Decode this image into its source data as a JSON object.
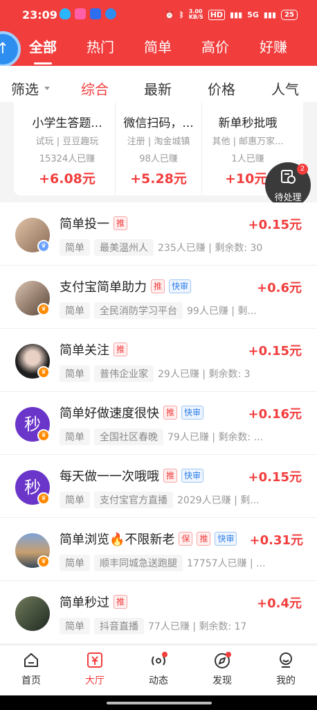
{
  "status_bar": {
    "time": "23:09",
    "speed": "3.00\nKB/S",
    "battery": "25",
    "signal": "5G",
    "network": "HD"
  },
  "top_tabs": [
    {
      "label": "全部"
    },
    {
      "label": "热门"
    },
    {
      "label": "简单"
    },
    {
      "label": "高价"
    },
    {
      "label": "好赚"
    }
  ],
  "filter": {
    "shaixuan": "筛选",
    "sorts": [
      "综合",
      "最新",
      "价格",
      "人气"
    ]
  },
  "cards": [
    {
      "title": "小学生答题...",
      "sub": "试玩 | 豆豆趣玩",
      "count": "15324人已赚",
      "reward": "+6.08元"
    },
    {
      "title": "微信扫码，...",
      "sub": "注册 | 淘金城镇",
      "count": "98人已赚",
      "reward": "+5.28元"
    },
    {
      "title": "新单秒批哦",
      "sub": "其他 | 邮惠万家...",
      "count": "1人已赚",
      "reward": "+10元"
    }
  ],
  "pending": {
    "label": "待处理",
    "badge": "2"
  },
  "tasks": [
    {
      "title": "简单投一",
      "tags": [
        "推"
      ],
      "reward": "+0.15元",
      "category": "简单",
      "shop": "最美温州人",
      "stats": "235人已赚 | 剩余数: 30",
      "avatar_text": "",
      "avatar_color": "#c9a183"
    },
    {
      "title": "支付宝简单助力",
      "tags": [
        "推",
        "快审"
      ],
      "reward": "+0.6元",
      "category": "简单",
      "shop": "全民消防学习平台",
      "stats": "99人已赚 | 剩...",
      "avatar_text": "",
      "avatar_color": "#8e6f5a"
    },
    {
      "title": "简单关注",
      "tags": [
        "推"
      ],
      "reward": "+0.15元",
      "category": "简单",
      "shop": "普伟企业家",
      "stats": "29人已赚 | 剩余数: 3",
      "avatar_text": "",
      "avatar_color": "#2b2b2b"
    },
    {
      "title": "简单好做速度很快",
      "tags": [
        "推",
        "快审"
      ],
      "reward": "+0.16元",
      "category": "简单",
      "shop": "全国社区春晚",
      "stats": "79人已赚 | 剩余数: ...",
      "avatar_text": "秒",
      "avatar_color": "#6a35c9"
    },
    {
      "title": "每天做一一次哦哦",
      "tags": [
        "推",
        "快审"
      ],
      "reward": "+0.15元",
      "category": "简单",
      "shop": "支付宝官方直播",
      "stats": "2029人已赚 | 剩...",
      "avatar_text": "秒",
      "avatar_color": "#6a35c9"
    },
    {
      "title": "简单浏览🔥不限新老",
      "tags": [
        "保",
        "推",
        "快审"
      ],
      "reward": "+0.31元",
      "category": "简单",
      "shop": "顺丰同城急送跑腿",
      "stats": "17757人已赚 | ...",
      "avatar_text": "",
      "avatar_color": "#5a7aa6"
    },
    {
      "title": "简单秒过",
      "tags": [
        "推"
      ],
      "reward": "+0.4元",
      "category": "简单",
      "shop": "抖音直播",
      "stats": "77人已赚 | 剩余数: 17",
      "avatar_text": "",
      "avatar_color": "#3d4a3a"
    }
  ],
  "bottom_nav": [
    {
      "label": "首页",
      "icon": "home-icon"
    },
    {
      "label": "大厅",
      "icon": "hall-icon"
    },
    {
      "label": "动态",
      "icon": "activity-icon"
    },
    {
      "label": "发现",
      "icon": "discover-icon"
    },
    {
      "label": "我的",
      "icon": "profile-icon"
    }
  ],
  "colors": {
    "primary": "#f23d3d",
    "accent_blue": "#2b7de9"
  }
}
